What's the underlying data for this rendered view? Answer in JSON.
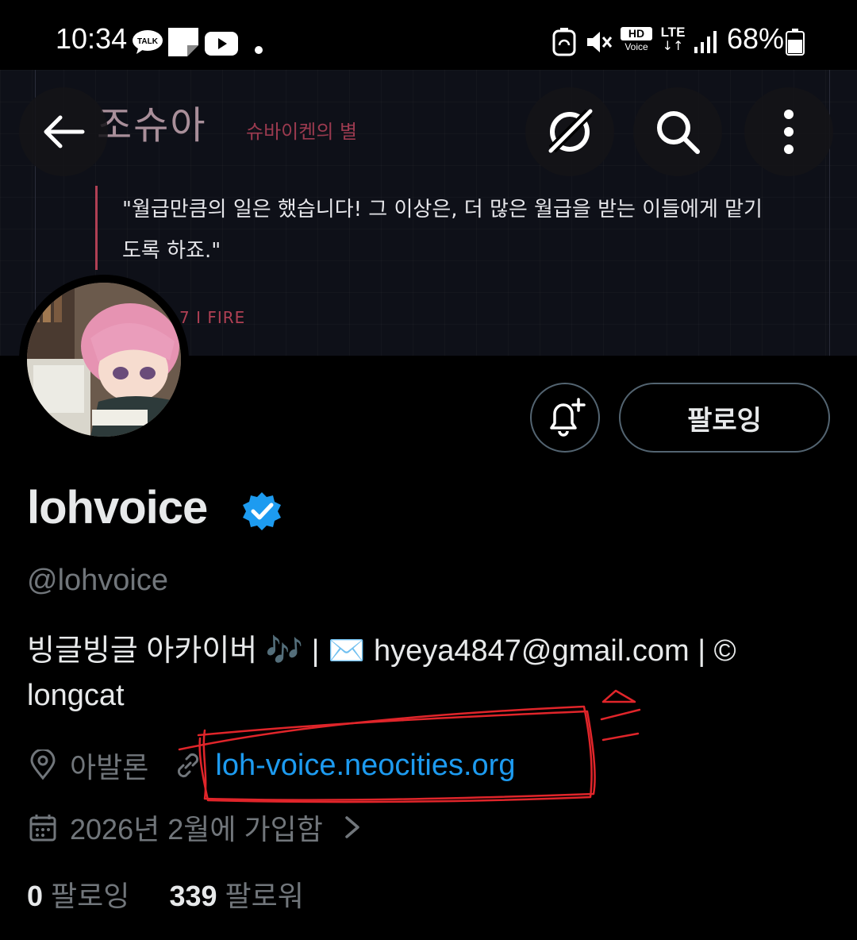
{
  "status_bar": {
    "time": "10:34",
    "notif_icons": [
      "talk-icon",
      "note-icon",
      "youtube-icon",
      "dot-icon"
    ],
    "right_icons": [
      "recycle-icon",
      "mute-icon",
      "hd-voice-icon",
      "lte-icon",
      "signal-icon",
      "battery-icon"
    ],
    "hd_label": "HD",
    "voice_label": "Voice",
    "lte_label": "LTE",
    "battery": "68%"
  },
  "banner": {
    "title": "조슈아",
    "subtitle": "슈바이켄의 별",
    "quote": "\"월급만큼의 일은 했습니다! 그 이상은, 더 많은 월급을 받는 이들에게 맡기도록 하죠.\"",
    "tag": "7 I FIRE"
  },
  "actions": {
    "follow_label": "팔로잉"
  },
  "profile": {
    "name": "lohvoice",
    "handle": "@lohvoice",
    "bio_line1": "빙글빙글 아카이버 🎶 | ✉️ hyeya4847@gmail.com | ©",
    "bio_line2": "longcat",
    "location": "아발론",
    "website": "loh-voice.neocities.org",
    "joined": "2026년 2월에 가입함",
    "following_count": "0",
    "following_label": "팔로잉",
    "followers_count": "339",
    "followers_label": "팔로워"
  },
  "colors": {
    "accent": "#1d9bf0",
    "secondary_text": "#71767b",
    "annotation": "#e0252a"
  }
}
